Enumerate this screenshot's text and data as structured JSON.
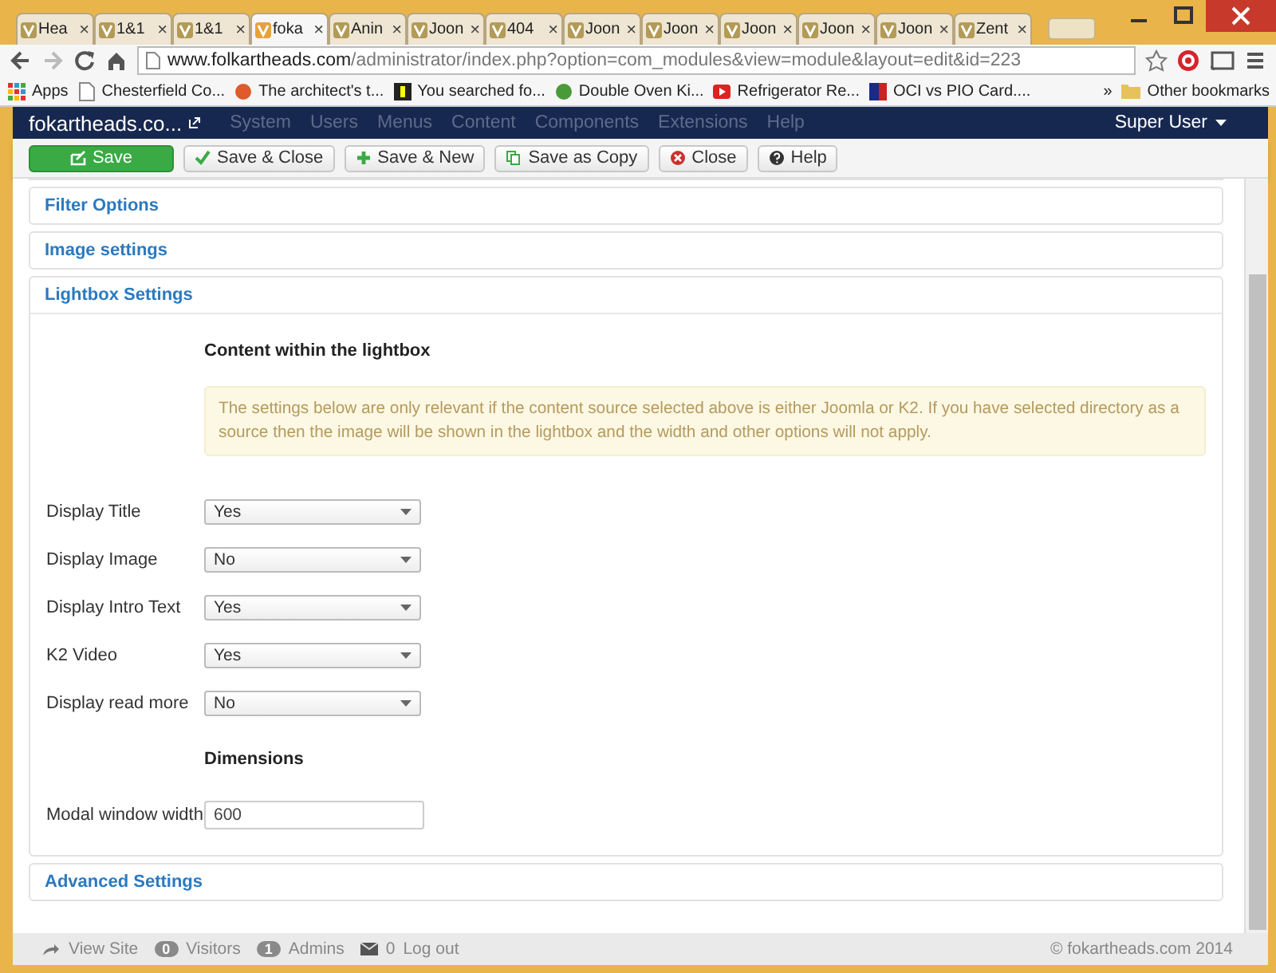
{
  "browser": {
    "tabs": [
      {
        "label": "Hea",
        "selected": false
      },
      {
        "label": "1&1",
        "selected": false
      },
      {
        "label": "1&1",
        "selected": false
      },
      {
        "label": "foka",
        "selected": true
      },
      {
        "label": "Anin",
        "selected": false
      },
      {
        "label": "Joon",
        "selected": false
      },
      {
        "label": "404",
        "selected": false
      },
      {
        "label": "Joon",
        "selected": false
      },
      {
        "label": "Joon",
        "selected": false
      },
      {
        "label": "Joon",
        "selected": false
      },
      {
        "label": "Joon",
        "selected": false
      },
      {
        "label": "Joon",
        "selected": false
      },
      {
        "label": "Zent",
        "selected": false
      }
    ],
    "tab_close": "×",
    "address": {
      "host": "www.folkartheads.com",
      "path": "/administrator/index.php?option=com_modules&view=module&layout=edit&id=223"
    },
    "bookmarks": [
      "Apps",
      "Chesterfield Co...",
      "The architect's t...",
      "You searched fo...",
      "Double Oven Ki...",
      "Refrigerator Re...",
      "OCI vs PIO Card...."
    ],
    "bookmarks_more": "»",
    "other_bookmarks": "Other bookmarks"
  },
  "navbar": {
    "brand": "fokartheads.co...",
    "menus": [
      "System",
      "Users",
      "Menus",
      "Content",
      "Components",
      "Extensions",
      "Help"
    ],
    "user": "Super User"
  },
  "toolbar": [
    {
      "label": "Save",
      "kind": "primary"
    },
    {
      "label": "Save & Close",
      "kind": "default"
    },
    {
      "label": "Save & New",
      "kind": "default"
    },
    {
      "label": "Save as Copy",
      "kind": "default"
    },
    {
      "label": "Close",
      "kind": "default"
    },
    {
      "label": "Help",
      "kind": "default"
    }
  ],
  "panels": [
    {
      "title": "Filter Options",
      "expanded": false
    },
    {
      "title": "Image settings",
      "expanded": false
    },
    {
      "title": "Lightbox Settings",
      "expanded": true,
      "heading": "Content within the lightbox",
      "notice": "The settings below are only relevant if the content source selected above is either Joomla or K2. If you have selected directory as a source then the image will be shown in the lightbox and the width and other options will not apply.",
      "fields": [
        {
          "kind": "select",
          "label": "Display Title",
          "value": "Yes"
        },
        {
          "kind": "select",
          "label": "Display Image",
          "value": "No"
        },
        {
          "kind": "select",
          "label": "Display Intro Text",
          "value": "Yes"
        },
        {
          "kind": "select",
          "label": "K2 Video",
          "value": "Yes"
        },
        {
          "kind": "select",
          "label": "Display read more",
          "value": "No"
        },
        {
          "kind": "heading",
          "label": "Dimensions"
        },
        {
          "kind": "text",
          "label": "Modal window width",
          "value": "600"
        }
      ]
    },
    {
      "title": "Advanced Settings",
      "expanded": false
    }
  ],
  "footer": {
    "view_site": "View Site",
    "visitors_count": "0",
    "visitors": "Visitors",
    "admins_count": "1",
    "admins": "Admins",
    "messages_count": "0",
    "logout": "Log out",
    "copyright": "© fokartheads.com 2014"
  }
}
